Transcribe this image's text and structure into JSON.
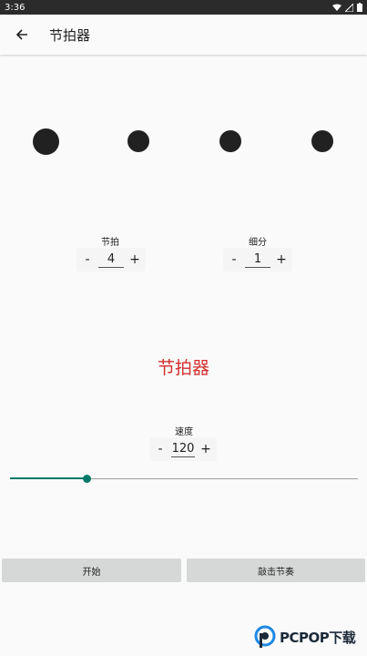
{
  "status_bar": {
    "time": "3:36",
    "icons": [
      "wifi-icon",
      "signal-icon",
      "battery-icon"
    ]
  },
  "app_bar": {
    "back_icon": "arrow-back-icon",
    "title": "节拍器"
  },
  "beats": {
    "count": 4,
    "accent_index": 0,
    "color": "#212121"
  },
  "beat_counter": {
    "label": "节拍",
    "value": "4",
    "minus": "-",
    "plus": "+"
  },
  "subdivision_counter": {
    "label": "细分",
    "value": "1",
    "minus": "-",
    "plus": "+"
  },
  "main_title": {
    "text": "节拍器",
    "color": "#d32f2f"
  },
  "tempo": {
    "label": "速度",
    "value": "120",
    "minus": "-",
    "plus": "+"
  },
  "tempo_slider": {
    "fraction": 0.22,
    "color": "#00796b"
  },
  "actions": {
    "start_label": "开始",
    "tap_label": "敲击节奏"
  },
  "watermark": {
    "text": "PCPOP下载"
  }
}
